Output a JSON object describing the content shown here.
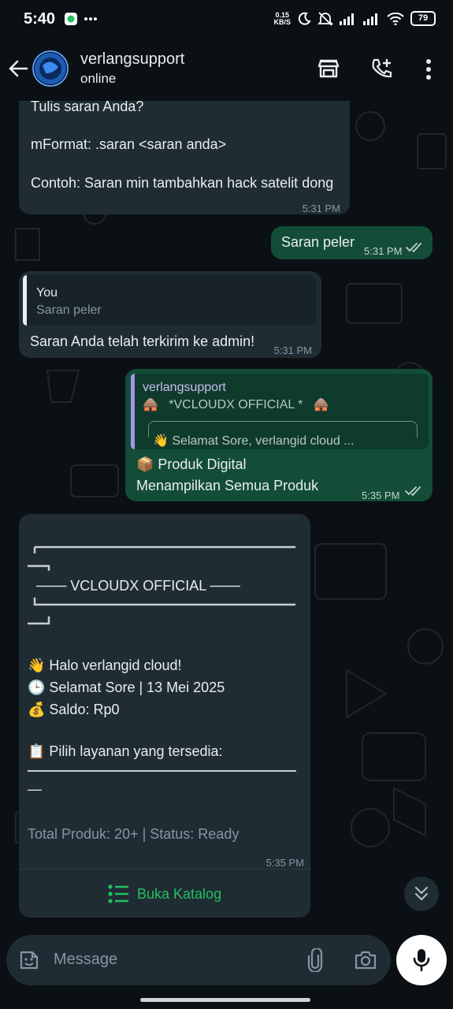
{
  "status_bar": {
    "time": "5:40",
    "net_speed_value": "0.15",
    "net_speed_unit": "KB/S",
    "battery": "79"
  },
  "header": {
    "contact_name": "verlangsupport",
    "contact_status": "online",
    "icons": [
      "back-arrow-icon",
      "store-icon",
      "add-call-icon",
      "more-vertical-icon"
    ]
  },
  "messages": {
    "m1": {
      "line1": "Tulis saran Anda?",
      "line2": "mFormat: .saran <saran anda>",
      "line3": "Contoh: Saran min tambahkan hack satelit dong",
      "time": "5:31 PM"
    },
    "m2": {
      "text": "Saran peler",
      "time": "5:31 PM"
    },
    "m3": {
      "quote_author": "You",
      "quote_text": "Saran peler",
      "text": "Saran Anda telah terkirim ke admin!",
      "time": "5:31 PM"
    },
    "m4": {
      "quote_author": "verlangsupport",
      "quote_line1": "🛖   *VCLOUDX OFFICIAL *   🛖",
      "quote_line2": "👋 Selamat Sore, verlangid cloud ...",
      "line1": "📦 Produk Digital",
      "line2": "Menampilkan Semua Produk",
      "time": "5:35 PM"
    },
    "m5": {
      "title": "─── VCLOUDX OFFICIAL ───",
      "greeting": "👋 Halo verlangid cloud!",
      "date_line": "🕒 Selamat Sore | 13 Mei 2025",
      "balance": "💰 Saldo: Rp0",
      "prompt": "📋 Pilih layanan yang tersedia:",
      "dash": "—",
      "footer": "Total Produk: 20+ | Status: Ready",
      "time": "5:35 PM",
      "action_label": "Buka Katalog"
    }
  },
  "input": {
    "placeholder": "Message"
  },
  "colors": {
    "background": "#0b1014",
    "incoming_bubble": "#1f2c33",
    "outgoing_bubble": "#134d37",
    "accent_green": "#21c063",
    "read_ticks": "#c2d5cc"
  }
}
